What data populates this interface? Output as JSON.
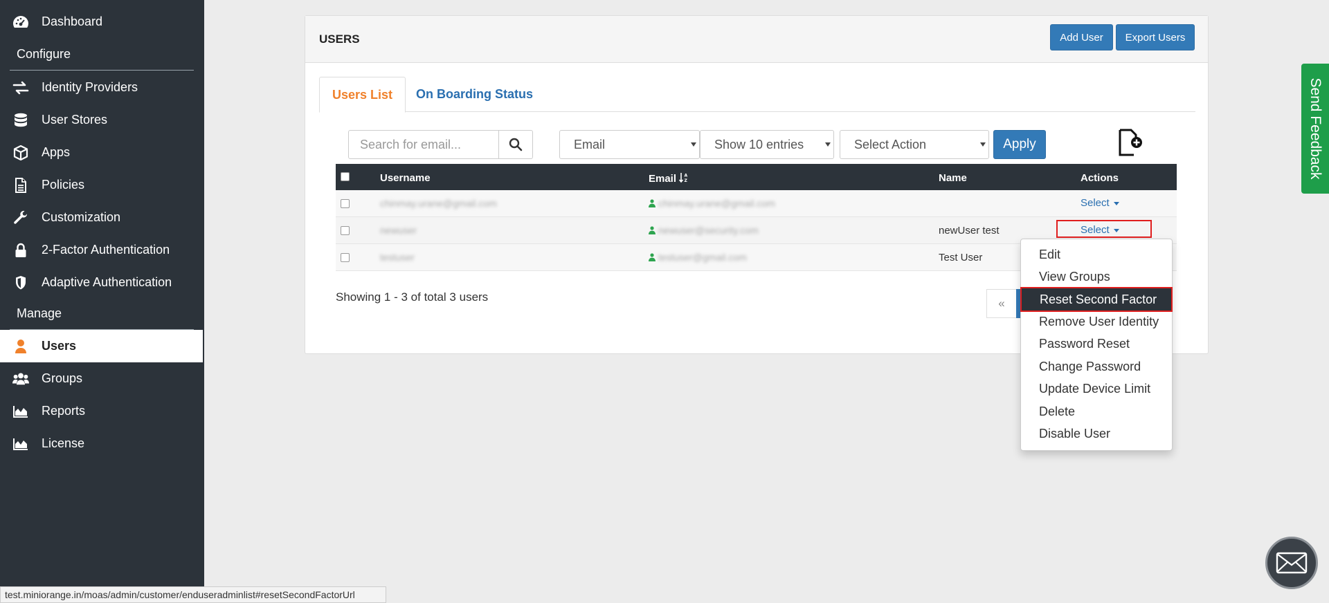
{
  "sidebar": {
    "items": [
      {
        "label": "Dashboard",
        "icon": "dashboard-icon"
      },
      {
        "label": "Identity Providers",
        "icon": "exchange-icon"
      },
      {
        "label": "User Stores",
        "icon": "database-icon"
      },
      {
        "label": "Apps",
        "icon": "cube-icon"
      },
      {
        "label": "Policies",
        "icon": "document-icon"
      },
      {
        "label": "Customization",
        "icon": "wrench-icon"
      },
      {
        "label": "2-Factor Authentication",
        "icon": "lock-icon"
      },
      {
        "label": "Adaptive Authentication",
        "icon": "shield-icon"
      },
      {
        "label": "Users",
        "icon": "user-icon"
      },
      {
        "label": "Groups",
        "icon": "users-icon"
      },
      {
        "label": "Reports",
        "icon": "area-chart-icon"
      },
      {
        "label": "License",
        "icon": "area-chart-icon"
      }
    ],
    "section_configure": "Configure",
    "section_manage": "Manage",
    "active_item": "Users",
    "active_color": "#f0812b"
  },
  "panel": {
    "title": "USERS",
    "add_user_label": "Add User",
    "export_users_label": "Export Users"
  },
  "tabs": {
    "users_list": "Users List",
    "onboarding": "On Boarding Status"
  },
  "filters": {
    "search_placeholder": "Search for email...",
    "search_field": "Email",
    "entries": "Show 10 entries",
    "action": "Select Action",
    "apply_label": "Apply"
  },
  "table": {
    "headers": {
      "username": "Username",
      "email": "Email",
      "name": "Name",
      "actions": "Actions"
    },
    "rows": [
      {
        "username": "chinmay.urane@gmail.com",
        "email": "chinmay.urane@gmail.com",
        "name": "",
        "action": "Select"
      },
      {
        "username": "newuser",
        "email": "newuser@security.com",
        "name": "newUser test",
        "action": "Select"
      },
      {
        "username": "testuser",
        "email": "testuser@gmail.com",
        "name": "Test User",
        "action": "Select"
      }
    ]
  },
  "showing": "Showing 1 - 3 of total 3 users",
  "pager": {
    "prev": "«"
  },
  "dropdown": {
    "items": [
      "Edit",
      "View Groups",
      "Reset Second Factor",
      "Remove User Identity",
      "Password Reset",
      "Change Password",
      "Update Device Limit",
      "Delete",
      "Disable User"
    ],
    "highlighted": "Reset Second Factor"
  },
  "feedback_label": "Send Feedback",
  "status_url": "test.miniorange.in/moas/admin/customer/enduseradminlist#resetSecondFactorUrl",
  "colors": {
    "sidebar_bg": "#2c333a",
    "primary": "#337ab7",
    "accent_orange": "#f0812b",
    "feedback_green": "#1e9e4a",
    "highlight_red": "#e01e1e",
    "email_verified_green": "#2ea44f"
  }
}
